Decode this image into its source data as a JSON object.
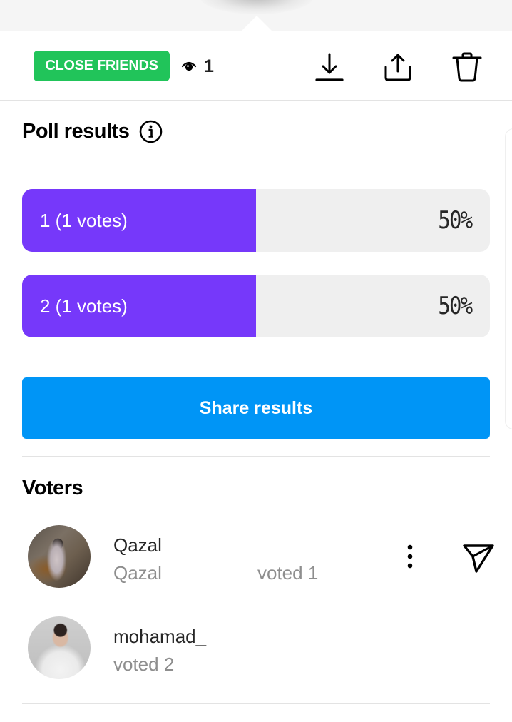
{
  "header": {
    "audience_badge": "CLOSE FRIENDS",
    "view_count": "1",
    "icons": {
      "views": "eye-icon",
      "download": "download-icon",
      "share": "share-icon",
      "delete": "trash-icon"
    },
    "badge_color": "#21c45a"
  },
  "poll": {
    "title": "Poll results",
    "info_icon": "info-icon",
    "accent_color": "#7638fa",
    "options": [
      {
        "label": "1 (1 votes)",
        "percent_text": "50%",
        "fraction": 0.5
      },
      {
        "label": "2 (1 votes)",
        "percent_text": "50%",
        "fraction": 0.5
      }
    ],
    "share_button": "Share results",
    "share_color": "#0095f6"
  },
  "voters": {
    "title": "Voters",
    "list": [
      {
        "username": "Qazal",
        "full_name": "Qazal",
        "vote_text": "voted 1",
        "more_icon": "more-vertical-icon",
        "send_icon": "send-icon"
      },
      {
        "username": "mohamad_",
        "vote_text": "voted 2"
      }
    ]
  }
}
